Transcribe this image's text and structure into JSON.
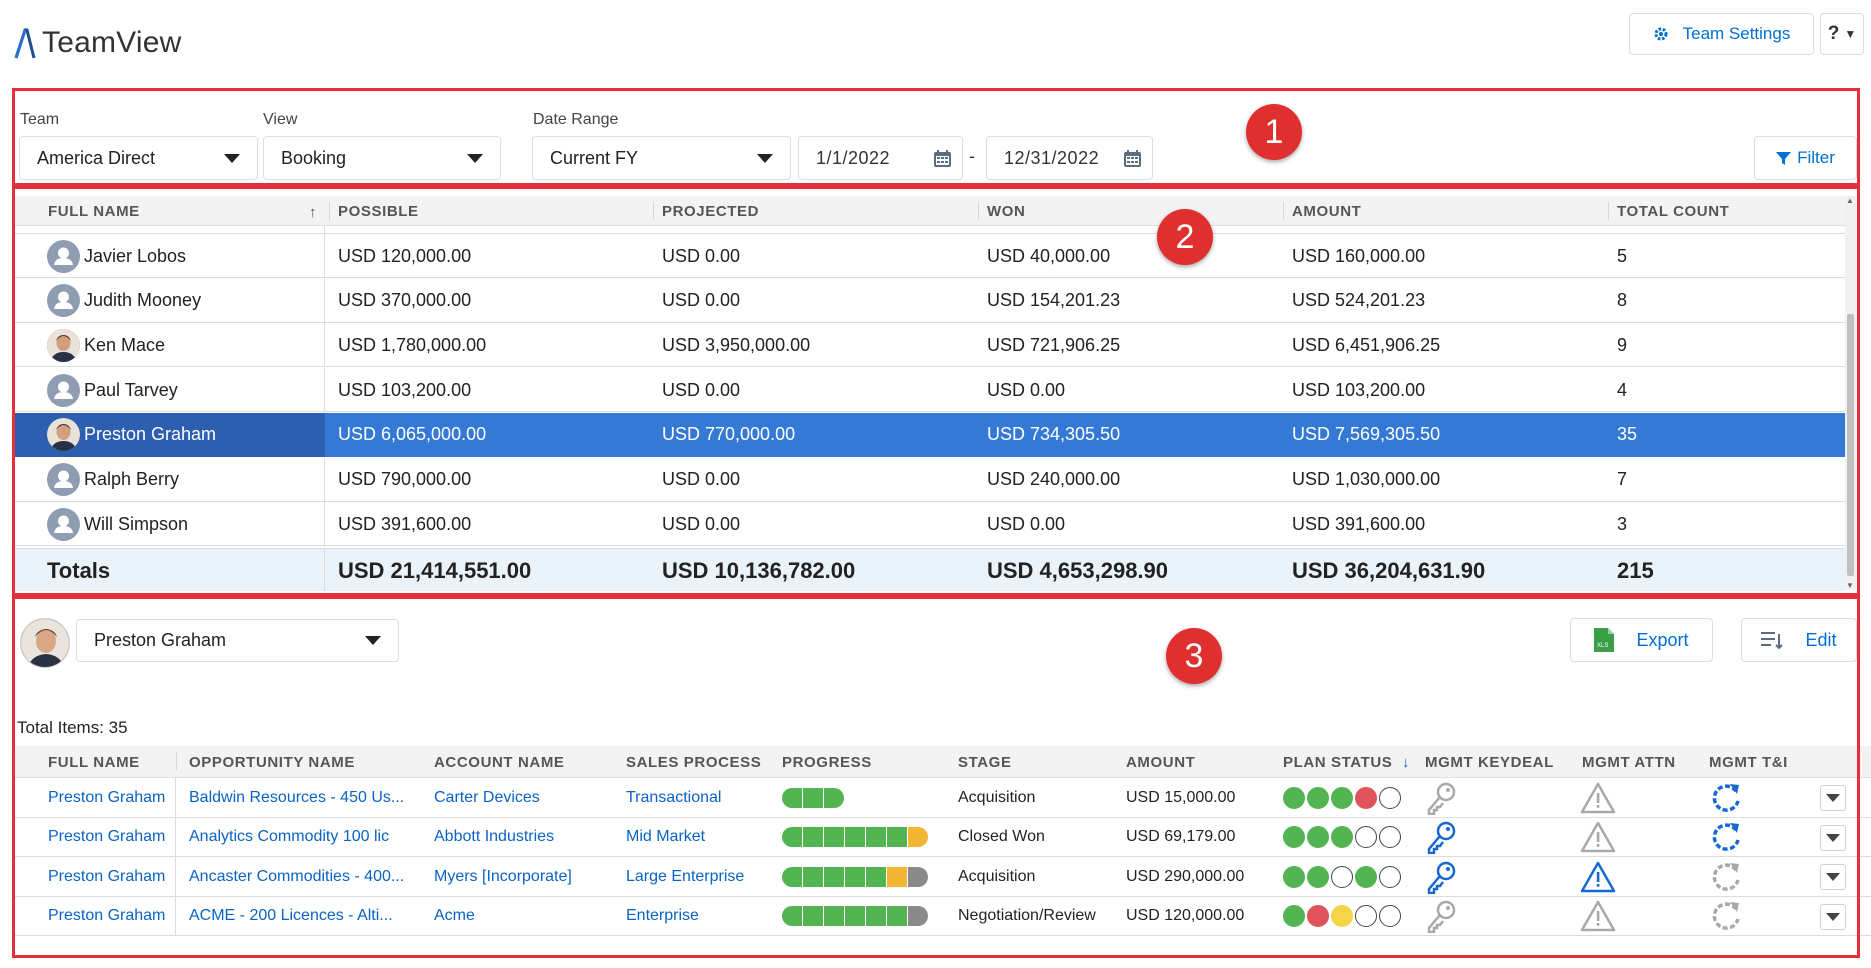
{
  "app": {
    "title": "TeamView"
  },
  "header": {
    "team_settings_label": "Team Settings",
    "help_label": "?"
  },
  "callouts": [
    "1",
    "2",
    "3"
  ],
  "filters": {
    "team_label": "Team",
    "team_value": "America Direct",
    "view_label": "View",
    "view_value": "Booking",
    "date_range_label": "Date Range",
    "date_range_value": "Current FY",
    "start_date": "1/1/2022",
    "separator": "-",
    "end_date": "12/31/2022",
    "filter_label": "Filter"
  },
  "summary": {
    "columns": [
      "FULL NAME",
      "POSSIBLE",
      "PROJECTED",
      "WON",
      "AMOUNT",
      "TOTAL COUNT"
    ],
    "sorted_column": "FULL NAME",
    "rows": [
      {
        "name": "Javier Lobos",
        "possible": "USD 120,000.00",
        "projected": "USD 0.00",
        "won": "USD 40,000.00",
        "amount": "USD 160,000.00",
        "count": "5"
      },
      {
        "name": "Judith Mooney",
        "possible": "USD 370,000.00",
        "projected": "USD 0.00",
        "won": "USD 154,201.23",
        "amount": "USD 524,201.23",
        "count": "8"
      },
      {
        "name": "Ken Mace",
        "possible": "USD 1,780,000.00",
        "projected": "USD 3,950,000.00",
        "won": "USD 721,906.25",
        "amount": "USD 6,451,906.25",
        "count": "9"
      },
      {
        "name": "Paul Tarvey",
        "possible": "USD 103,200.00",
        "projected": "USD 0.00",
        "won": "USD 0.00",
        "amount": "USD 103,200.00",
        "count": "4"
      },
      {
        "name": "Preston Graham",
        "possible": "USD 6,065,000.00",
        "projected": "USD 770,000.00",
        "won": "USD 734,305.50",
        "amount": "USD 7,569,305.50",
        "count": "35"
      },
      {
        "name": "Ralph Berry",
        "possible": "USD 790,000.00",
        "projected": "USD 0.00",
        "won": "USD 240,000.00",
        "amount": "USD 1,030,000.00",
        "count": "7"
      },
      {
        "name": "Will Simpson",
        "possible": "USD 391,600.00",
        "projected": "USD 0.00",
        "won": "USD 0.00",
        "amount": "USD 391,600.00",
        "count": "3"
      }
    ],
    "selected_row": "Preston Graham",
    "totals": {
      "label": "Totals",
      "possible": "USD 21,414,551.00",
      "projected": "USD 10,136,782.00",
      "won": "USD 4,653,298.90",
      "amount": "USD 36,204,631.90",
      "count": "215"
    }
  },
  "detail": {
    "person": "Preston Graham",
    "export_label": "Export",
    "edit_label": "Edit",
    "total_items": "Total Items: 35",
    "columns": [
      "FULL NAME",
      "OPPORTUNITY NAME",
      "ACCOUNT NAME",
      "SALES PROCESS",
      "PROGRESS",
      "STAGE",
      "AMOUNT",
      "PLAN STATUS",
      "MGMT KEYDEAL",
      "MGMT ATTN",
      "MGMT T&I"
    ],
    "sorted_column": "PLAN STATUS",
    "rows": [
      {
        "full_name": "Preston Graham",
        "opportunity": "Baldwin Resources - 450 Us...",
        "account": "Carter Devices",
        "process": "Transactional",
        "progress": [
          "G",
          "G",
          "G"
        ],
        "stage": "Acquisition",
        "amount": "USD 15,000.00",
        "plan_status": [
          "G",
          "G",
          "G",
          "R",
          "O"
        ],
        "keydeal": "inactive",
        "attn": "inactive",
        "ti": "active"
      },
      {
        "full_name": "Preston Graham",
        "opportunity": "Analytics Commodity 100 lic",
        "account": "Abbott Industries",
        "process": "Mid Market",
        "progress": [
          "G",
          "G",
          "G",
          "G",
          "G",
          "G",
          "Y"
        ],
        "stage": "Closed Won",
        "amount": "USD 69,179.00",
        "plan_status": [
          "G",
          "G",
          "G",
          "O",
          "O"
        ],
        "keydeal": "active",
        "attn": "inactive",
        "ti": "active"
      },
      {
        "full_name": "Preston Graham",
        "opportunity": "Ancaster Commodities - 400...",
        "account": "Myers [Incorporate]",
        "process": "Large Enterprise",
        "progress": [
          "G",
          "G",
          "G",
          "G",
          "G",
          "Y",
          "N"
        ],
        "stage": "Acquisition",
        "amount": "USD 290,000.00",
        "plan_status": [
          "G",
          "G",
          "O",
          "G",
          "O"
        ],
        "keydeal": "active",
        "attn": "active",
        "ti": "inactive"
      },
      {
        "full_name": "Preston Graham",
        "opportunity": "ACME - 200 Licences - Alti...",
        "account": "Acme",
        "process": "Enterprise",
        "progress": [
          "G",
          "G",
          "G",
          "G",
          "G",
          "G",
          "N"
        ],
        "stage": "Negotiation/Review",
        "amount": "USD 120,000.00",
        "plan_status": [
          "G",
          "R",
          "Y",
          "O",
          "O"
        ],
        "keydeal": "inactive",
        "attn": "inactive",
        "ti": "inactive"
      }
    ]
  },
  "colors": {
    "accent": "#0070d2",
    "selected_row": "#3579d6",
    "callout": "#e5303b",
    "progress_green": "#52b552",
    "progress_yellow": "#f2b632"
  }
}
